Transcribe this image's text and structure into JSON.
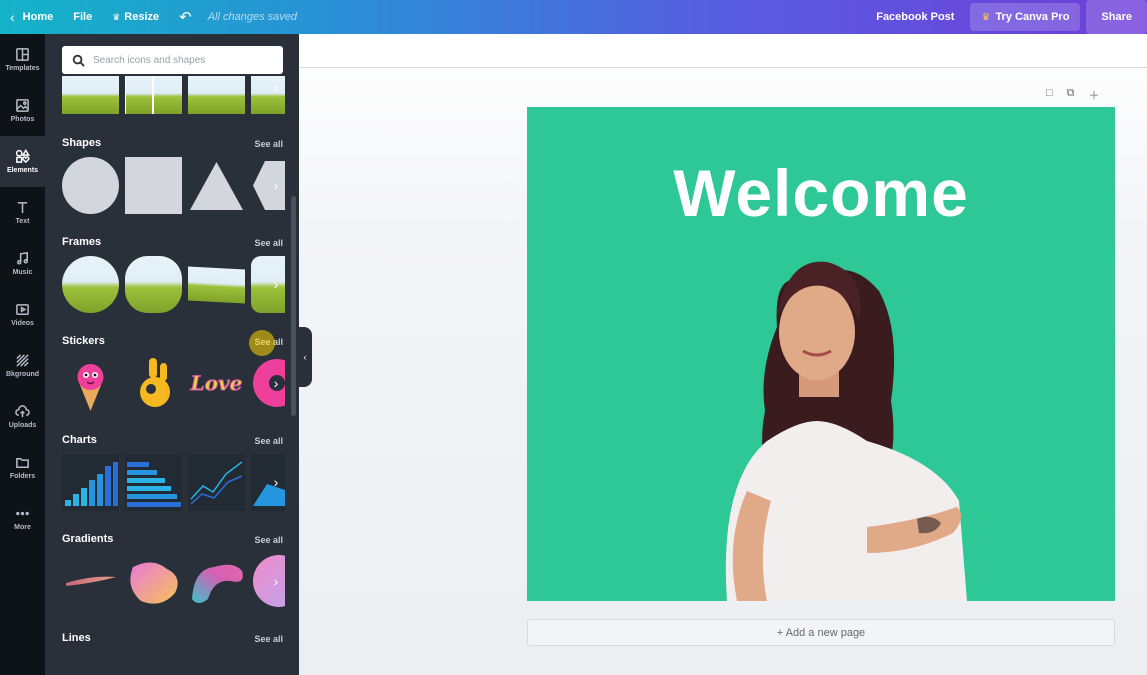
{
  "topbar": {
    "home": "Home",
    "file": "File",
    "resize": "Resize",
    "saved_status": "All changes saved",
    "doc_type": "Facebook Post",
    "try_pro": "Try Canva Pro",
    "share": "Share"
  },
  "rail": {
    "items": [
      {
        "label": "Templates",
        "icon": "templates-icon"
      },
      {
        "label": "Photos",
        "icon": "photos-icon"
      },
      {
        "label": "Elements",
        "icon": "elements-icon"
      },
      {
        "label": "Text",
        "icon": "text-icon"
      },
      {
        "label": "Music",
        "icon": "music-icon"
      },
      {
        "label": "Videos",
        "icon": "videos-icon"
      },
      {
        "label": "Bkground",
        "icon": "background-icon"
      },
      {
        "label": "Uploads",
        "icon": "uploads-icon"
      },
      {
        "label": "Folders",
        "icon": "folders-icon"
      },
      {
        "label": "More",
        "icon": "more-icon"
      }
    ]
  },
  "panel": {
    "search_placeholder": "Search icons and shapes",
    "see_all": "See all",
    "sections": {
      "shapes": "Shapes",
      "frames": "Frames",
      "stickers": "Stickers",
      "charts": "Charts",
      "gradients": "Gradients",
      "lines": "Lines"
    },
    "sticker_love_text": "Love"
  },
  "canvas": {
    "heading": "Welcome",
    "add_page": "+ Add a new page",
    "background_color": "#2ec896"
  },
  "colors": {
    "accent_gradient_start": "#14b3c8",
    "accent_gradient_end": "#6f3fd9",
    "panel_bg": "#293039",
    "rail_bg": "#0e1318"
  }
}
